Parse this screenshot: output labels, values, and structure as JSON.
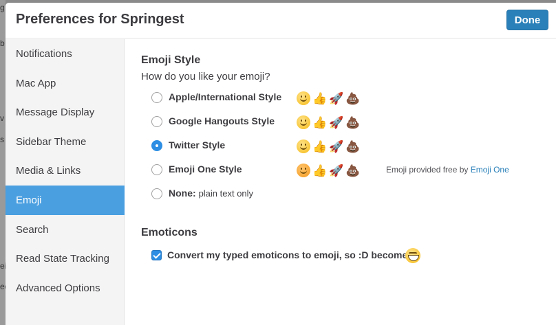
{
  "backdrop": {
    "fragments": [
      "g",
      "b",
      "v",
      "s",
      "ei",
      "ed"
    ]
  },
  "modal": {
    "title": "Preferences for Springest",
    "done_label": "Done"
  },
  "sidebar": {
    "items": [
      {
        "label": "Notifications",
        "active": false
      },
      {
        "label": "Mac App",
        "active": false
      },
      {
        "label": "Message Display",
        "active": false
      },
      {
        "label": "Sidebar Theme",
        "active": false
      },
      {
        "label": "Media & Links",
        "active": false
      },
      {
        "label": "Emoji",
        "active": true
      },
      {
        "label": "Search",
        "active": false
      },
      {
        "label": "Read State Tracking",
        "active": false
      },
      {
        "label": "Advanced Options",
        "active": false
      }
    ]
  },
  "emoji_style": {
    "title": "Emoji Style",
    "subtitle": "How do you like your emoji?",
    "options": [
      {
        "label": "Apple/International Style",
        "checked": false,
        "icons": [
          "smiley-icon",
          "thumbs-up-icon",
          "rocket-icon",
          "poop-icon"
        ]
      },
      {
        "label": "Google Hangouts Style",
        "checked": false,
        "icons": [
          "smiley-icon",
          "thumbs-up-icon",
          "rocket-icon",
          "poop-icon"
        ]
      },
      {
        "label": "Twitter Style",
        "checked": true,
        "icons": [
          "smiley-icon",
          "thumbs-up-icon",
          "rocket-icon",
          "poop-icon"
        ]
      },
      {
        "label": "Emoji One Style",
        "checked": false,
        "icons": [
          "smiley-icon",
          "thumbs-up-icon",
          "rocket-icon",
          "poop-icon"
        ]
      },
      {
        "label": "None:",
        "label_plain": "plain text only",
        "checked": false
      }
    ],
    "credit_text": "Emoji provided free by",
    "credit_link": "Emoji One"
  },
  "emoticons": {
    "title": "Emoticons",
    "checkbox_label": "Convert my typed emoticons to emoji, so  :D  becomes",
    "checked": true
  },
  "colors": {
    "accent": "#4a9fe0",
    "button": "#2a80b9",
    "radio_checked": "#2d8ee3"
  }
}
